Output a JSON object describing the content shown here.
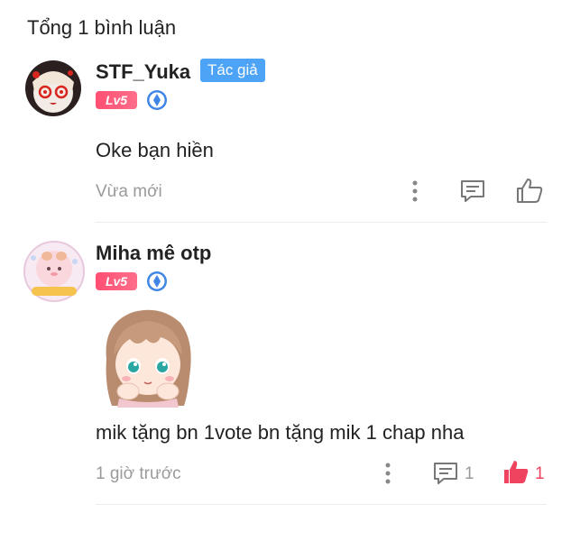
{
  "header": {
    "total_label": "Tổng 1 bình luận"
  },
  "comments": [
    {
      "username": "STF_Yuka",
      "author_tag": "Tác giả",
      "level": "Lv5",
      "text": "Oke bạn hiền",
      "time": "Vừa mới"
    },
    {
      "username": "Miha mê otp",
      "level": "Lv5",
      "text": "mik tặng bn 1vote bn tặng mik 1 chap nha",
      "time": "1 giờ trước",
      "reply_count": "1",
      "like_count": "1"
    }
  ],
  "colors": {
    "author_tag": "#4da3f5",
    "level_badge": "#ff4f73",
    "liked": "#f0435f",
    "muted_text": "#9a9a9a"
  },
  "icons": {
    "more": "more-vertical-icon",
    "reply": "comment-icon",
    "like": "thumbs-up-icon"
  }
}
